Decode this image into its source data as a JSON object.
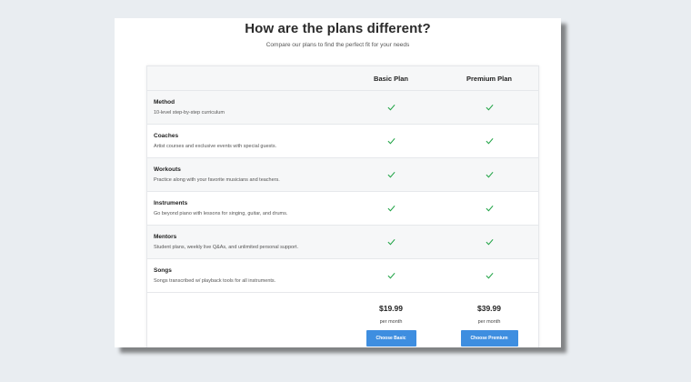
{
  "header": {
    "title": "How are the plans different?",
    "subtitle": "Compare our plans to find the perfect fit for your needs"
  },
  "plans": [
    {
      "name": "Basic Plan",
      "price": "$19.99",
      "period": "per month",
      "button_label": "Choose Basic"
    },
    {
      "name": "Premium Plan",
      "price": "$39.99",
      "period": "per month",
      "button_label": "Choose Premium"
    }
  ],
  "features": [
    {
      "name": "Method",
      "description": "10-level step-by-step curriculum",
      "basic": true,
      "premium": true
    },
    {
      "name": "Coaches",
      "description": "Artist courses and exclusive events with special guests.",
      "basic": true,
      "premium": true
    },
    {
      "name": "Workouts",
      "description": "Practice along with your favorite musicians and teachers.",
      "basic": true,
      "premium": true
    },
    {
      "name": "Instruments",
      "description": "Go beyond piano with lessons for singing, guitar, and drums.",
      "basic": true,
      "premium": true
    },
    {
      "name": "Mentors",
      "description": "Student plans, weekly live Q&As, and unlimited personal support.",
      "basic": true,
      "premium": true
    },
    {
      "name": "Songs",
      "description": "Songs transcribed w/ playback tools for all instruments.",
      "basic": true,
      "premium": true
    }
  ],
  "colors": {
    "check": "#22a447",
    "button": "#3e8ee0"
  },
  "icons": {
    "check": "check-icon"
  }
}
